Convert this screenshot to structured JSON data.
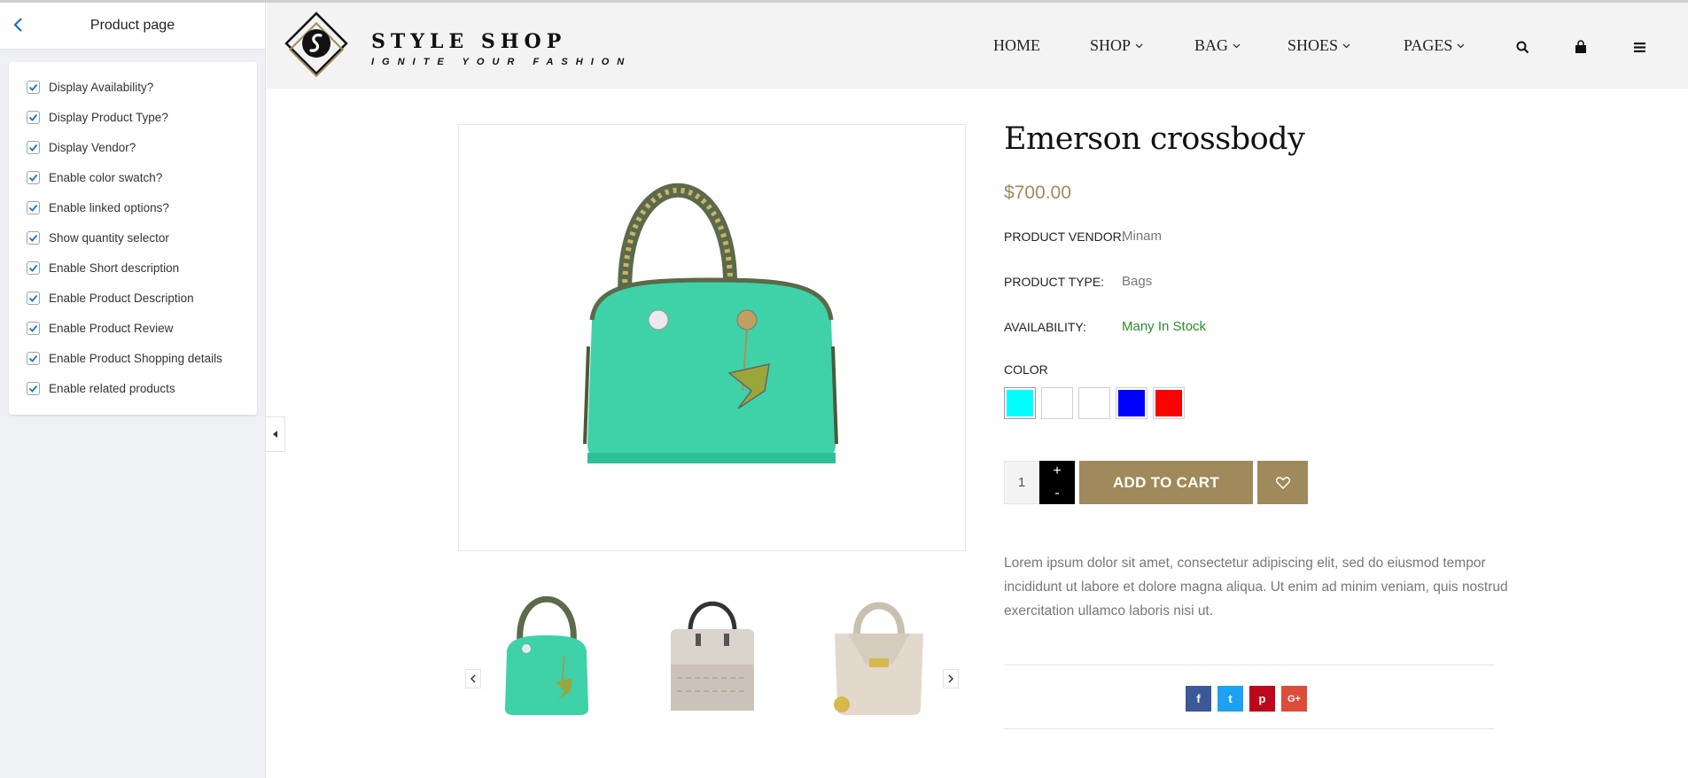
{
  "sidebar": {
    "title": "Product page",
    "options": [
      {
        "label": "Display Availability?",
        "checked": true
      },
      {
        "label": "Display Product Type?",
        "checked": true
      },
      {
        "label": "Display Vendor?",
        "checked": true
      },
      {
        "label": "Enable color swatch?",
        "checked": true
      },
      {
        "label": "Enable linked options?",
        "checked": true
      },
      {
        "label": "Show quantity selector",
        "checked": true
      },
      {
        "label": "Enable Short description",
        "checked": true
      },
      {
        "label": "Enable Product Description",
        "checked": true
      },
      {
        "label": "Enable Product Review",
        "checked": true
      },
      {
        "label": "Enable Product Shopping details",
        "checked": true
      },
      {
        "label": "Enable related products",
        "checked": true
      }
    ]
  },
  "header": {
    "brand": "STYLE SHOP",
    "tagline": "IGNITE YOUR FASHION",
    "nav": [
      {
        "label": "HOME",
        "has_dropdown": false
      },
      {
        "label": "SHOP",
        "has_dropdown": true
      },
      {
        "label": "BAG",
        "has_dropdown": true
      },
      {
        "label": "SHOES",
        "has_dropdown": true
      },
      {
        "label": "PAGES",
        "has_dropdown": true
      }
    ],
    "icons": [
      "search-icon",
      "cart-icon",
      "menu-icon"
    ]
  },
  "product": {
    "title": "Emerson crossbody",
    "price": "$700.00",
    "vendor_label": "PRODUCT VENDOR:",
    "vendor": "Minam",
    "type_label": "PRODUCT TYPE:",
    "type": "Bags",
    "availability_label": "AVAILABILITY:",
    "availability": "Many In Stock",
    "color_label": "COLOR",
    "swatches": [
      "#00ffff",
      "#ffffff",
      "#ffffff",
      "#0000ff",
      "#ff0000"
    ],
    "quantity": "1",
    "plus": "+",
    "minus": "-",
    "add_to_cart": "ADD TO CART",
    "description": "Lorem ipsum dolor sit amet, consectetur adipiscing elit, sed do eiusmod tempor incididunt ut labore et dolore magna aliqua. Ut enim ad minim veniam, quis nostrud exercitation ullamco laboris nisi ut."
  },
  "social": [
    {
      "name": "facebook-icon",
      "glyph": "f",
      "color": "#3b5998"
    },
    {
      "name": "twitter-icon",
      "glyph": "t",
      "color": "#1da1f2"
    },
    {
      "name": "pinterest-icon",
      "glyph": "p",
      "color": "#bd081c"
    },
    {
      "name": "google-plus-icon",
      "glyph": "G+",
      "color": "#dd4b39"
    }
  ],
  "colors": {
    "accent": "#a08a5c",
    "in_stock": "#2e8b2e",
    "checkbox": "#1a73c4"
  }
}
